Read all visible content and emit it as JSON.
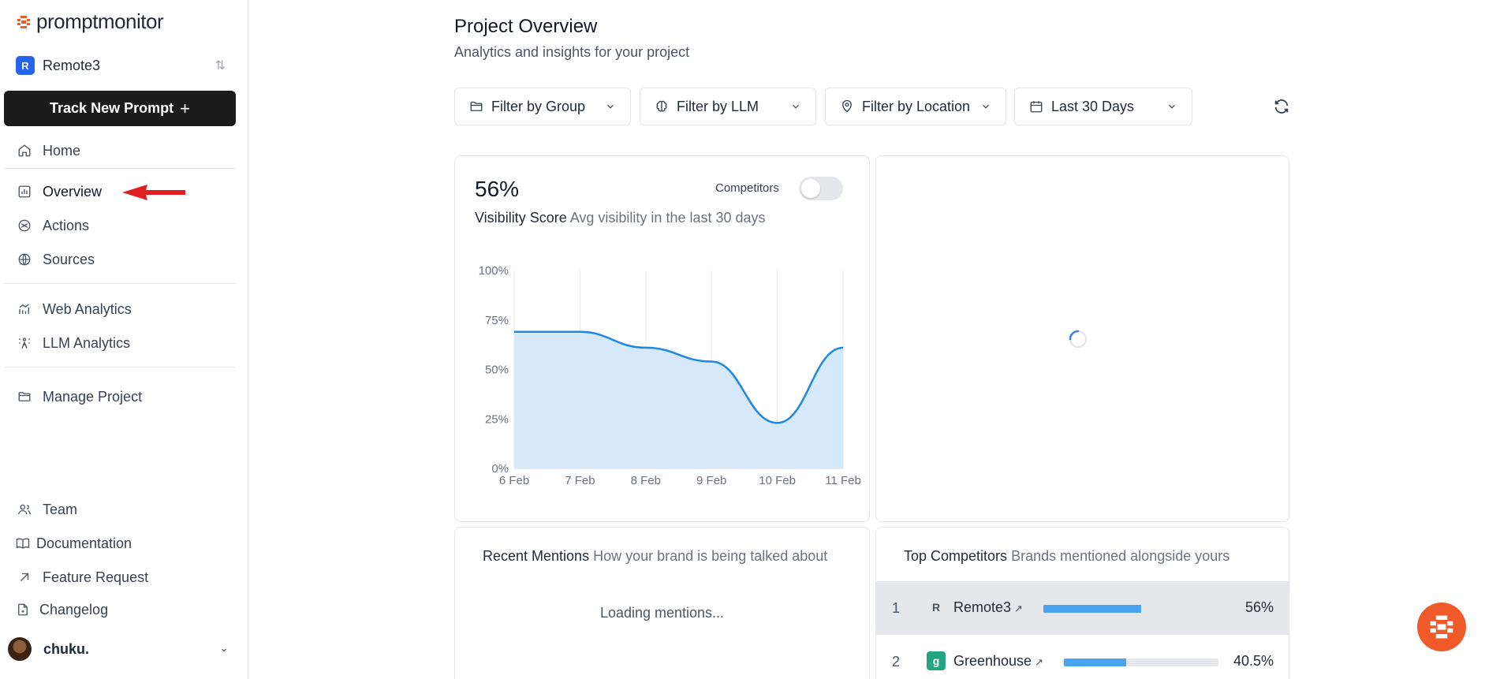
{
  "brand": {
    "name": "promptmonitor"
  },
  "project": {
    "name": "Remote3",
    "badge": "R"
  },
  "sidebar": {
    "track_button": "Track New Prompt",
    "items": [
      {
        "label": "Home",
        "icon": "home-icon"
      },
      {
        "label": "Overview",
        "icon": "bar-chart-icon"
      },
      {
        "label": "Actions",
        "icon": "actions-icon"
      },
      {
        "label": "Sources",
        "icon": "globe-icon"
      },
      {
        "label": "Web Analytics",
        "icon": "line-chart-icon"
      },
      {
        "label": "LLM Analytics",
        "icon": "person-sparkle-icon"
      },
      {
        "label": "Manage Project",
        "icon": "folder-icon"
      }
    ],
    "footer_items": [
      {
        "label": "Team",
        "icon": "users-icon"
      },
      {
        "label": "Documentation",
        "icon": "book-icon"
      },
      {
        "label": "Feature Request",
        "icon": "arrow-up-right-icon"
      },
      {
        "label": "Changelog",
        "icon": "file-icon"
      }
    ],
    "user": {
      "name": "chuku."
    }
  },
  "header": {
    "title": "Project Overview",
    "subtitle": "Analytics and insights for your project"
  },
  "filters": [
    {
      "label": "Filter by Group",
      "icon": "folder-icon"
    },
    {
      "label": "Filter by LLM",
      "icon": "brain-icon"
    },
    {
      "label": "Filter by Location",
      "icon": "map-pin-icon"
    },
    {
      "label": "Last 30 Days",
      "icon": "calendar-icon"
    }
  ],
  "visibility": {
    "score": "56%",
    "competitors_label": "Competitors",
    "competitors_on": false,
    "title": "Visibility Score",
    "subtitle": "Avg visibility in the last 30 days"
  },
  "chart_data": {
    "type": "area",
    "title": "",
    "xlabel": "",
    "ylabel": "",
    "categories": [
      "6 Feb",
      "7 Feb",
      "8 Feb",
      "9 Feb",
      "10 Feb",
      "11 Feb"
    ],
    "values": [
      69,
      69,
      61,
      54,
      23,
      61
    ],
    "ylim": [
      0,
      100
    ],
    "yticks": [
      "0%",
      "25%",
      "50%",
      "75%",
      "100%"
    ],
    "grid": "vertical",
    "color": "#1e88e5",
    "fill": "#d6e9fa"
  },
  "mentions": {
    "title": "Recent Mentions",
    "subtitle": "How your brand is being talked about",
    "loading": "Loading mentions..."
  },
  "competitors": {
    "title": "Top Competitors",
    "subtitle": "Brands mentioned alongside yours",
    "rows": [
      {
        "rank": "1",
        "name": "Remote3",
        "icon_letter": "R",
        "pct": "56%",
        "value": 56
      },
      {
        "rank": "2",
        "name": "Greenhouse",
        "icon_letter": "g",
        "pct": "40.5%",
        "value": 40.5
      }
    ]
  },
  "colors": {
    "accent": "#f05a28",
    "project_badge": "#2563eb",
    "bar": "#4aa3f0",
    "greenhouse": "#24a47f"
  }
}
